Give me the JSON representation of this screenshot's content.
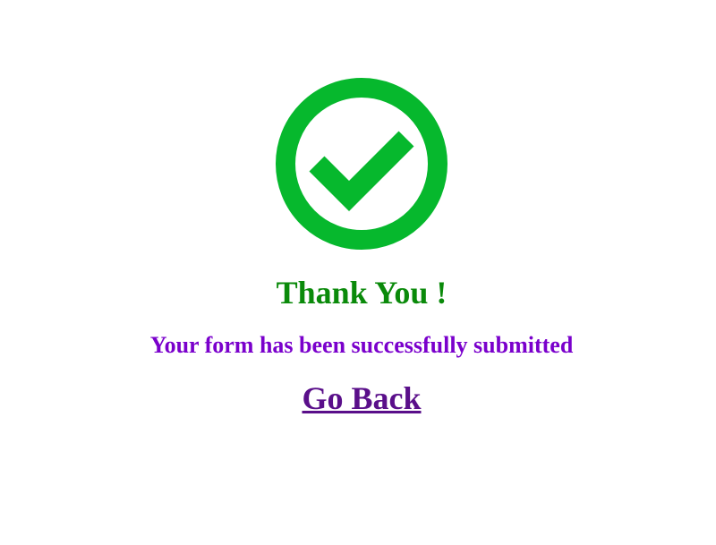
{
  "confirmation": {
    "icon": "check-circle-icon",
    "title": "Thank You !",
    "message": "Your form has been successfully submitted",
    "back_link_label": "Go Back"
  },
  "colors": {
    "icon": "#06b82d",
    "title": "#0a8a0a",
    "message": "#7a00cc",
    "link": "#5a0f8a",
    "background": "#ffffff"
  }
}
